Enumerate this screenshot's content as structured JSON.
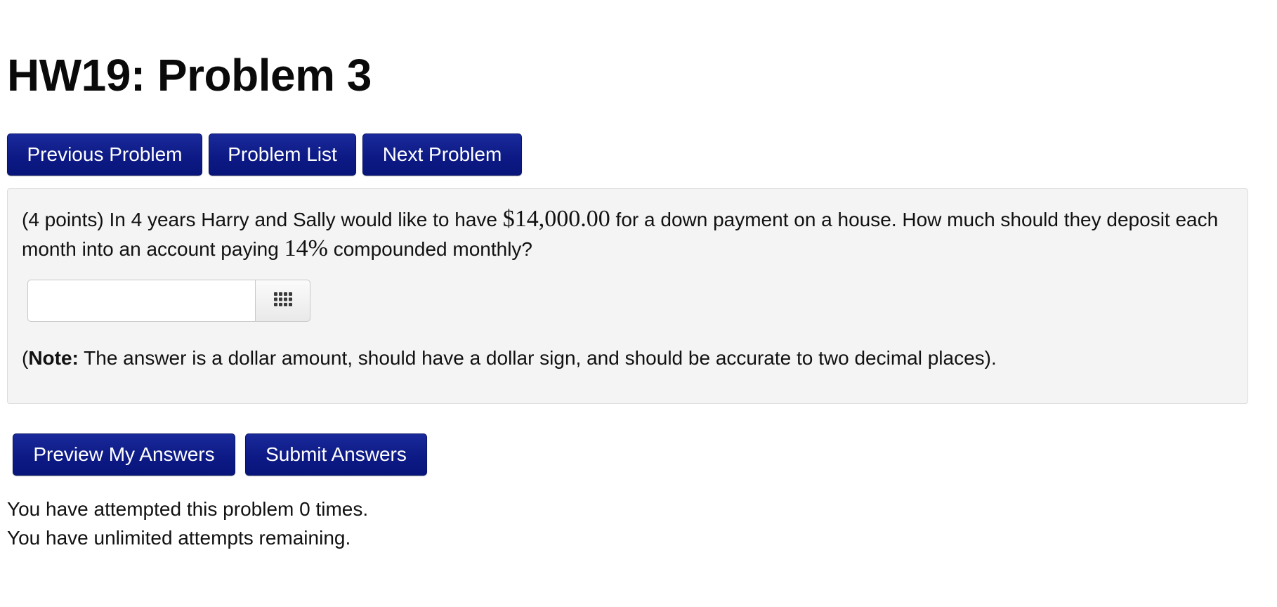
{
  "page": {
    "title": "HW19: Problem 3"
  },
  "nav": {
    "previous_label": "Previous Problem",
    "list_label": "Problem List",
    "next_label": "Next Problem"
  },
  "problem": {
    "intro": "(4 points) In 4 years Harry and Sally would like to have ",
    "amount": "$14,000.00",
    "middle": " for a down payment on a house. How much should they deposit each month into an account paying ",
    "rate": "14%",
    "end": " compounded monthly?",
    "answer_value": "",
    "answer_placeholder": "",
    "keypad_icon": "grid-keypad-icon",
    "note_open": "(",
    "note_label": "Note:",
    "note_body": " The answer is a dollar amount, should have a dollar sign, and should be accurate to two decimal places)."
  },
  "actions": {
    "preview_label": "Preview My Answers",
    "submit_label": "Submit Answers"
  },
  "status": {
    "attempts": "You have attempted this problem 0 times.",
    "remaining": "You have unlimited attempts remaining."
  }
}
